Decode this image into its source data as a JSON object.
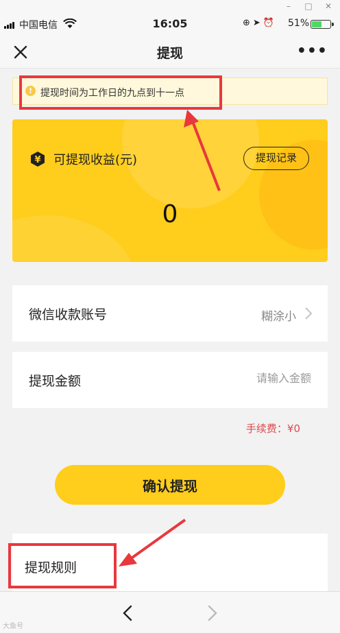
{
  "window": {
    "minimize": "–",
    "maximize": "□",
    "close": "✕"
  },
  "status": {
    "carrier": "中国电信",
    "time": "16:05",
    "battery_pct": "51%",
    "battery_level": 0.51
  },
  "nav": {
    "title": "提现",
    "more": "•••"
  },
  "notice": {
    "text": "提现时间为工作日的九点到十一点",
    "icon": "!"
  },
  "card": {
    "label": "可提现收益(元)",
    "record_button": "提现记录",
    "amount": "0",
    "yuan_symbol": "¥"
  },
  "account_row": {
    "label": "微信收款账号",
    "value": "糊涂小"
  },
  "amount_row": {
    "label": "提现金额",
    "placeholder": "请输入金额"
  },
  "fee": "手续费：¥0",
  "confirm_button": "确认提现",
  "rules": {
    "title": "提现规则"
  },
  "watermark": "大鱼号",
  "colors": {
    "accent": "#ffcd1c",
    "annotation": "#e8383d",
    "fee_text": "#e0474c"
  }
}
